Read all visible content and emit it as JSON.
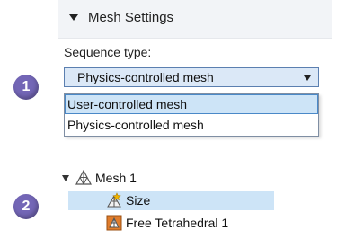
{
  "mesh_settings": {
    "section_title": "Mesh Settings",
    "sequence_type_label": "Sequence type:",
    "selected_value": "Physics-controlled mesh",
    "options": [
      "User-controlled mesh",
      "Physics-controlled mesh"
    ]
  },
  "callouts": {
    "step1": "1",
    "step2": "2"
  },
  "tree": {
    "root_label": "Mesh 1",
    "children": [
      "Size",
      "Free Tetrahedral 1"
    ]
  },
  "icons": {
    "section_toggle": "caret-down-icon",
    "combo_arrow": "chevron-down-icon",
    "mesh_root": "mesh-icon",
    "size_node": "size-icon",
    "free_tetrahedral_node": "free-tetrahedral-icon"
  },
  "colors": {
    "callout": "#7366b6",
    "selection": "#cde4f7",
    "selection_border": "#4a89c8"
  }
}
